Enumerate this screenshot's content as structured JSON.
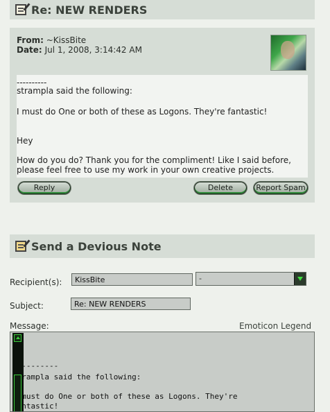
{
  "note": {
    "title": "Re: NEW RENDERS",
    "from_label": "From:",
    "from_value": "~KissBite",
    "date_label": "Date:",
    "date_value": "Jul 1, 2008, 3:14:42 AM",
    "body_lines": [
      "----------",
      "strampla said the following:",
      "I must do One or both of these as Logons. They're fantastic!",
      "Hey",
      "How do you do? Thank you for the compliment! Like I said before,",
      "please feel free to use my work in your own creative projects."
    ],
    "reply_label": "Reply",
    "delete_label": "Delete",
    "report_label": "Report Spam"
  },
  "send": {
    "title": "Send a Devious Note",
    "recipient_label": "Recipient(s):",
    "recipient_value": "KissBite",
    "select_value": "-",
    "subject_label": "Subject:",
    "subject_value": "Re: NEW RENDERS",
    "message_label": "Message:",
    "emoticon_label": "Emoticon Legend",
    "message_lines": [
      "----------",
      "strampla said the following:",
      "I must do One or both of these as Logons. They're",
      "fantastic!"
    ]
  },
  "colors": {
    "panel": "#d6ddd6",
    "background": "#eef1ec",
    "accent_green": "#3ccc3c"
  }
}
